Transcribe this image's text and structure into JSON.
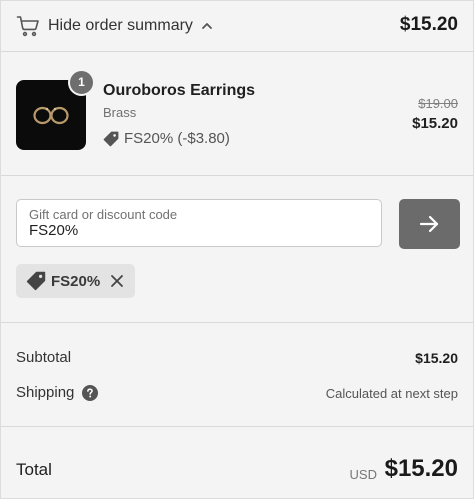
{
  "header": {
    "toggle_label": "Hide order summary",
    "total": "$15.20",
    "icons": {
      "cart": "cart-icon",
      "toggle": "chevron-up-icon"
    }
  },
  "product": {
    "quantity": "1",
    "name": "Ouroboros Earrings",
    "variant": "Brass",
    "discount_note": "FS20% (-$3.80)",
    "original_price": "$19.00",
    "price": "$15.20",
    "icons": {
      "discount": "tag-icon"
    }
  },
  "discount_code": {
    "label": "Gift card or discount code",
    "placeholder": "Gift card or discount code",
    "value": "FS20%",
    "apply_icon": "arrow-right-icon",
    "applied_code": "FS20%",
    "remove_icon": "close-icon"
  },
  "totals": {
    "subtotal_label": "Subtotal",
    "subtotal_value": "$15.20",
    "shipping_label": "Shipping",
    "shipping_value": "Calculated at next step",
    "shipping_help_icon": "help-icon"
  },
  "total": {
    "label": "Total",
    "currency": "USD",
    "amount": "$15.20"
  },
  "colors": {
    "background": "#f4f4f4",
    "button": "#6b6b6b",
    "chip": "#e3e3e3",
    "badge": "#6e6e6e"
  }
}
